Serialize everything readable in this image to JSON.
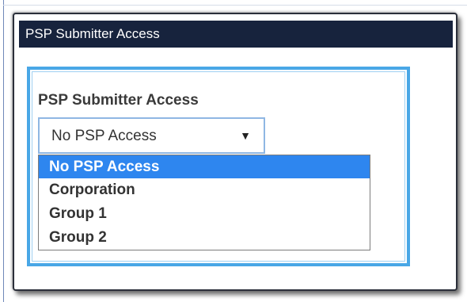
{
  "dialog": {
    "title": "PSP Submitter Access"
  },
  "field": {
    "label": "PSP Submitter Access",
    "selected_value": "No PSP Access",
    "arrow_glyph": "▼",
    "options": [
      {
        "label": "No PSP Access",
        "selected": true
      },
      {
        "label": "Corporation",
        "selected": false
      },
      {
        "label": "Group 1",
        "selected": false
      },
      {
        "label": "Group 2",
        "selected": false
      }
    ]
  },
  "colors": {
    "title_bar": "#17233d",
    "panel_border": "#49a7e6",
    "selected_option": "#2e86ef"
  },
  "icons": {
    "dropdown": "chevron-down-icon"
  }
}
